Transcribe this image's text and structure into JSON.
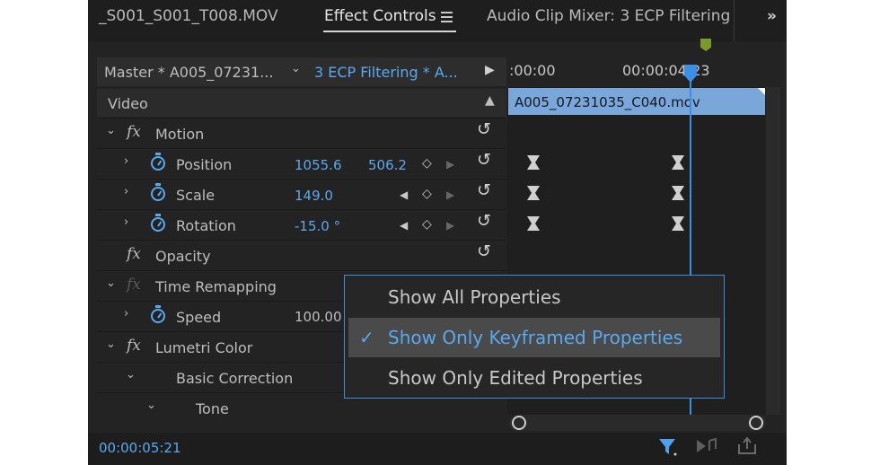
{
  "tabs": {
    "source_tab": "_S001_S001_T008.MOV",
    "effect_controls": "Effect Controls",
    "audio_clip_mixer": "Audio Clip Mixer: 3 ECP Filtering",
    "overflow": "»"
  },
  "header": {
    "master": "Master * A005_07231...",
    "sequence": "3 ECP Filtering * A..."
  },
  "timeline": {
    "time_start": ":00:00",
    "time_mid": "00:00:04:23",
    "clip_name": "A005_07231035_C040.mov"
  },
  "section": {
    "video_label": "Video"
  },
  "effects": {
    "motion": "Motion",
    "position": {
      "label": "Position",
      "x": "1055.6",
      "y": "506.2"
    },
    "scale": {
      "label": "Scale",
      "value": "149.0"
    },
    "rotation": {
      "label": "Rotation",
      "value": "-15.0 °"
    },
    "opacity": "Opacity",
    "time_remapping": "Time Remapping",
    "speed": {
      "label": "Speed",
      "value": "100.00"
    },
    "lumetri": "Lumetri Color",
    "basic_correction": "Basic Correction",
    "tone": "Tone"
  },
  "context_menu": {
    "items": [
      {
        "label": "Show All Properties",
        "selected": false
      },
      {
        "label": "Show Only Keyframed Properties",
        "selected": true
      },
      {
        "label": "Show Only Edited Properties",
        "selected": false
      }
    ]
  },
  "footer": {
    "timecode": "00:00:05:21"
  },
  "icons": {
    "fx": "fx",
    "reset": "reset-icon",
    "stopwatch": "stopwatch-icon",
    "filter": "filter-icon"
  },
  "colors": {
    "accent": "#5aa9ef",
    "clip": "#7aa7da",
    "playhead": "#3d8fe6"
  }
}
